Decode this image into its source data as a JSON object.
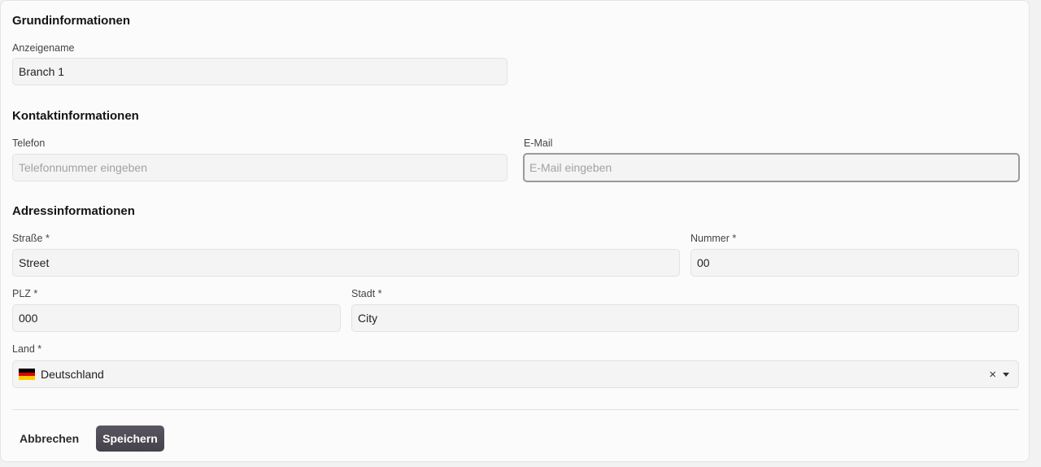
{
  "sections": {
    "basic": {
      "title": "Grundinformationen"
    },
    "contact": {
      "title": "Kontaktinformationen"
    },
    "address": {
      "title": "Adressinformationen"
    }
  },
  "fields": {
    "display_name": {
      "label": "Anzeigename",
      "value": "Branch 1"
    },
    "phone": {
      "label": "Telefon",
      "value": "",
      "placeholder": "Telefonnummer eingeben"
    },
    "email": {
      "label": "E-Mail",
      "value": "",
      "placeholder": "E-Mail eingeben"
    },
    "street": {
      "label": "Straße *",
      "value": "Street"
    },
    "number": {
      "label": "Nummer *",
      "value": "00"
    },
    "zip": {
      "label": "PLZ *",
      "value": "000"
    },
    "city": {
      "label": "Stadt *",
      "value": "City"
    },
    "country": {
      "label": "Land *",
      "value": "Deutschland",
      "flag_icon": "flag-de-icon",
      "flag_colors": [
        "#000000",
        "#dd0000",
        "#ffcc00"
      ]
    }
  },
  "actions": {
    "cancel_label": "Abbrechen",
    "save_label": "Speichern"
  }
}
